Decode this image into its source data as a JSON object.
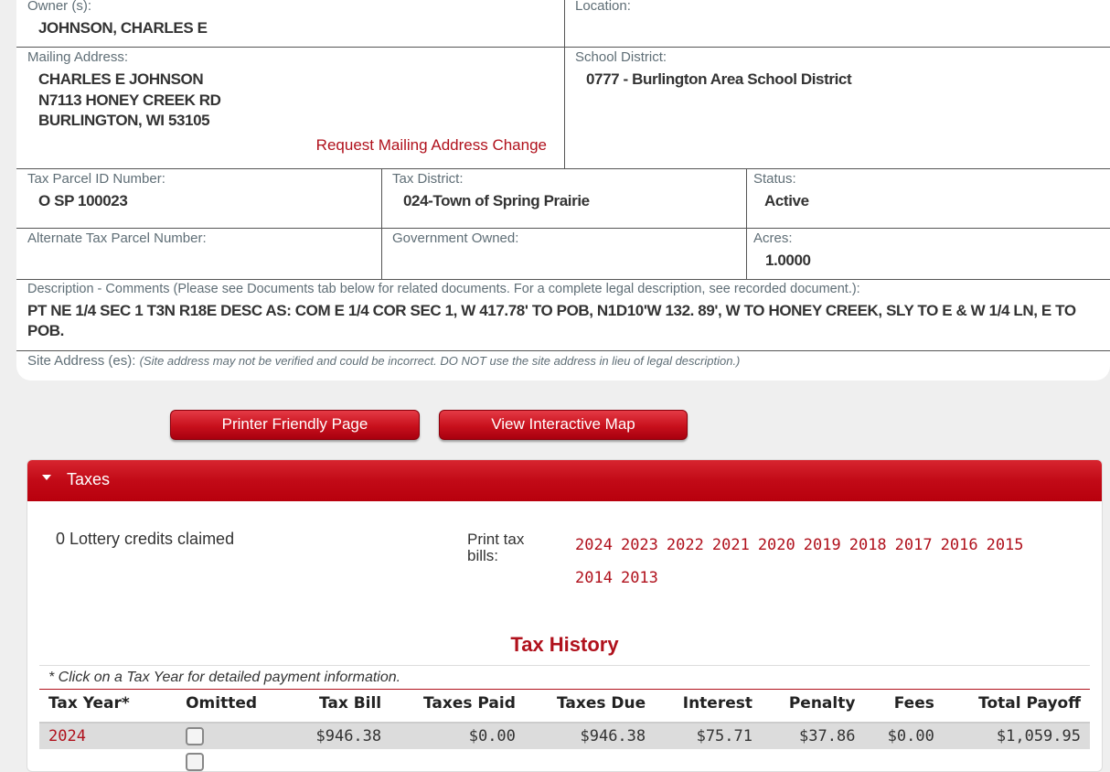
{
  "parcel": {
    "owner_label": "Owner (s):",
    "owner_value": "JOHNSON, CHARLES E",
    "location_label": "Location:",
    "mailing_label": "Mailing Address:",
    "mailing_lines": [
      "CHARLES E JOHNSON",
      "N7113 HONEY CREEK RD",
      "BURLINGTON, WI 53105"
    ],
    "mailing_change_link": "Request Mailing Address Change",
    "school_label": "School District:",
    "school_value": "0777 - Burlington Area School District",
    "tax_id_label": "Tax Parcel ID Number:",
    "tax_id_value": "O SP 100023",
    "tax_district_label": "Tax District:",
    "tax_district_value": "024-Town of Spring Prairie",
    "status_label": "Status:",
    "status_value": "Active",
    "alt_id_label": "Alternate Tax Parcel Number:",
    "gov_owned_label": "Government Owned:",
    "acres_label": "Acres:",
    "acres_value": "1.0000",
    "description_label": "Description - Comments (Please see Documents tab below for related documents. For a complete legal description, see recorded document.):",
    "description_value": "PT NE 1/4 SEC 1 T3N R18E DESC AS: COM E 1/4 COR SEC 1, W 417.78' TO POB, N1D10'W 132. 89', W TO HONEY CREEK, SLY TO E & W 1/4 LN, E TO POB.",
    "site_label": "Site Address (es):",
    "site_note": "(Site address may not be verified and could be incorrect. DO NOT use the site address in lieu of legal description.)"
  },
  "buttons": {
    "printer_friendly": "Printer Friendly Page",
    "interactive_map": "View Interactive Map"
  },
  "taxes": {
    "header": "Taxes",
    "lottery_text": "0 Lottery credits claimed",
    "print_label": "Print tax bills:",
    "years": [
      "2024",
      "2023",
      "2022",
      "2021",
      "2020",
      "2019",
      "2018",
      "2017",
      "2016",
      "2015",
      "2014",
      "2013"
    ],
    "history_title": "Tax History",
    "history_note": "* Click on a Tax Year for detailed payment information.",
    "columns": [
      "Tax Year*",
      "Omitted",
      "Tax Bill",
      "Taxes Paid",
      "Taxes Due",
      "Interest",
      "Penalty",
      "Fees",
      "Total Payoff"
    ],
    "rows": [
      {
        "year": "2024",
        "tax_bill": "$946.38",
        "taxes_paid": "$0.00",
        "taxes_due": "$946.38",
        "interest": "$75.71",
        "penalty": "$37.86",
        "fees": "$0.00",
        "total_payoff": "$1,059.95"
      }
    ]
  },
  "colors": {
    "accent": "#c20a17",
    "link": "#b0111c",
    "label": "#5f6e76"
  }
}
